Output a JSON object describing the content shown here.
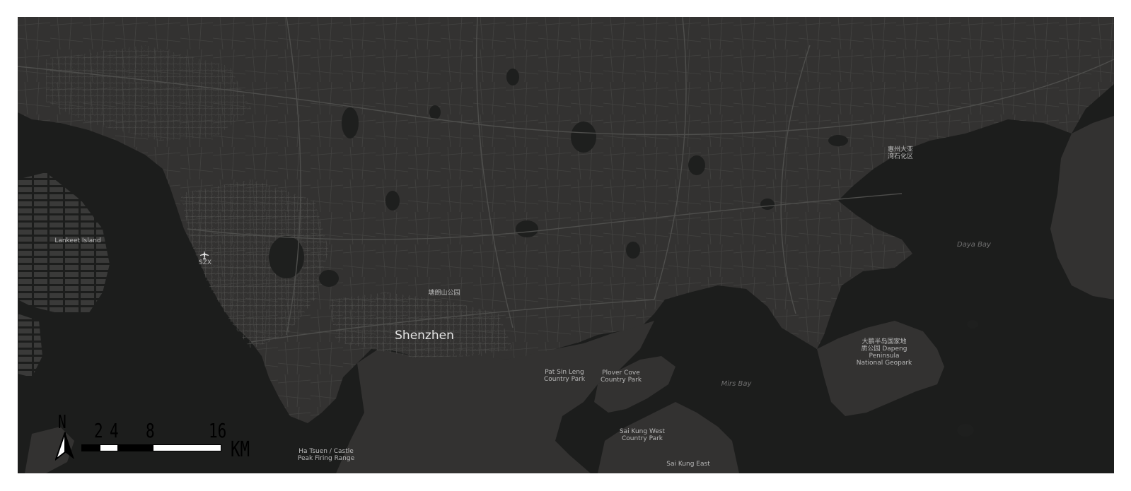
{
  "map": {
    "theme": "dark",
    "colors": {
      "land": "#333231",
      "water": "#1c1d1c",
      "urban_roads": "#4a4a48",
      "labels": "#b9b9b9",
      "water_labels": "#6f6f6f"
    },
    "labels": {
      "lankeet": "Lankeet Island",
      "airport_code": "SZX",
      "park_tanglang": "塘朗山公园",
      "city": "Shenzhen",
      "huizhou": "惠州大亚\n湾石化区",
      "daya_bay": "Daya Bay",
      "dapeng": "大鹏半岛国家地\n质公园 Dapeng\nPeninsula\nNational Geopark",
      "mirs_bay": "Mirs Bay",
      "pat_sin_leng": "Pat Sin Leng\nCountry Park",
      "plover_cove": "Plover Cove\nCountry Park",
      "sai_kung_west": "Sai Kung West\nCountry Park",
      "ha_tsuen": "Ha Tsuen / Castle\nPeak Firing Range",
      "sai_kung_east": "Sai Kung East"
    },
    "airport_icon": "airplane-icon"
  },
  "north_arrow": {
    "label": "N",
    "icon": "north-arrow-icon"
  },
  "scale_bar": {
    "ticks": [
      "2",
      "4",
      "8",
      "16"
    ],
    "unit": "KM"
  }
}
